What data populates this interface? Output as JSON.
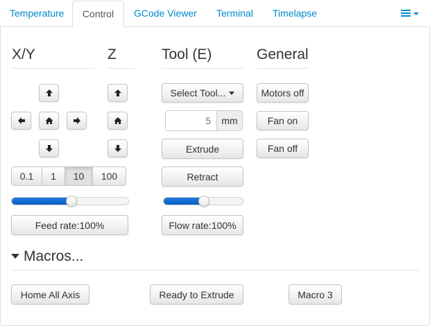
{
  "tabs": [
    {
      "label": "Temperature"
    },
    {
      "label": "Control"
    },
    {
      "label": "GCode Viewer"
    },
    {
      "label": "Terminal"
    },
    {
      "label": "Timelapse"
    }
  ],
  "active_tab": "Control",
  "colors": {
    "link": "#0088cc",
    "slider_fill": "#0a5fc2",
    "active_tab_text": "#555555"
  },
  "columns": {
    "xy": {
      "title": "X/Y"
    },
    "z": {
      "title": "Z"
    },
    "tool": {
      "title": "Tool (E)"
    },
    "general": {
      "title": "General"
    }
  },
  "jog": {
    "step_sizes": [
      "0.1",
      "1",
      "10",
      "100"
    ],
    "selected_step": "10",
    "feed_rate_label": "Feed rate:100%",
    "feed_rate_slider_fraction": 0.51
  },
  "tool": {
    "select_label": "Select Tool...",
    "amount_value": "",
    "amount_placeholder": "5",
    "amount_unit": "mm",
    "extrude_label": "Extrude",
    "retract_label": "Retract",
    "flow_rate_label": "Flow rate:100%",
    "flow_rate_slider_fraction": 0.51
  },
  "general": {
    "motors_off": "Motors off",
    "fan_on": "Fan on",
    "fan_off": "Fan off"
  },
  "macros": {
    "header": "Macros...",
    "buttons": [
      "Home All Axis",
      "Ready to Extrude",
      "Macro 3"
    ]
  }
}
